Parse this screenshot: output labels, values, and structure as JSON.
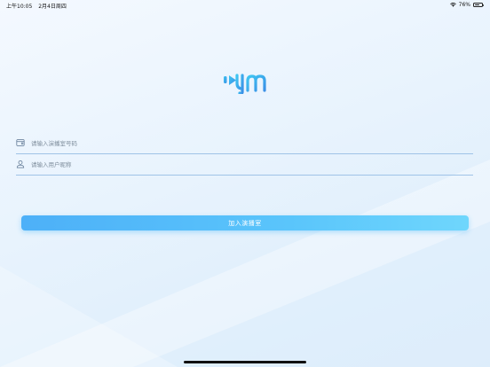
{
  "status_bar": {
    "time": "上午10:05",
    "date": "2月4日周四",
    "battery_percent": "76%",
    "battery_level": 0.76
  },
  "logo": {
    "icon": "ym-logo",
    "accent": "#3fb0f0"
  },
  "form": {
    "room_number": {
      "icon": "room-card-icon",
      "placeholder": "请输入演播室号码",
      "value": ""
    },
    "nickname": {
      "icon": "user-icon",
      "placeholder": "请输入用户昵称",
      "value": ""
    }
  },
  "join_button": {
    "label": "加入演播室",
    "color": "#4db0f8"
  }
}
